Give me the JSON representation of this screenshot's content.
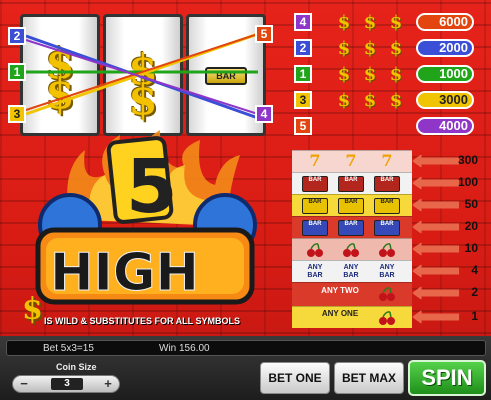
{
  "reels": {
    "reel1": {
      "top": "$",
      "mid": "$"
    },
    "reel2": {
      "top": "$",
      "mid": "$"
    },
    "reel3": {
      "bar": "BAR"
    }
  },
  "payline_markers": {
    "left": [
      {
        "label": "2",
        "color": "#3a4fd6"
      },
      {
        "label": "1",
        "color": "#1fa41a"
      },
      {
        "label": "3",
        "color": "#f0c400"
      }
    ],
    "right": [
      {
        "label": "5",
        "color": "#e2450e"
      },
      {
        "label": "4",
        "color": "#8f35c8"
      }
    ]
  },
  "logo": {
    "number": "5",
    "word": "HIGH"
  },
  "wild_note": {
    "symbol": "$",
    "text": "IS WILD & SUBSTITUTES FOR ALL SYMBOLS"
  },
  "line_wins": [
    {
      "line": "4",
      "symbols": [
        "$",
        "$",
        "$"
      ],
      "value": "6000",
      "color": "#8f35c8"
    },
    {
      "line": "2",
      "symbols": [
        "$",
        "$",
        "$"
      ],
      "value": "2000",
      "color": "#3a4fd6"
    },
    {
      "line": "1",
      "symbols": [
        "$",
        "$",
        "$"
      ],
      "value": "1000",
      "color": "#1fa41a"
    },
    {
      "line": "3",
      "symbols": [
        "$",
        "$",
        "$"
      ],
      "value": "3000",
      "color": "#f0c400"
    },
    {
      "line": "5",
      "symbols": [],
      "value": "4000",
      "color": "#8f35c8"
    }
  ],
  "paytable": [
    {
      "symbols": [
        "7",
        "7",
        "7"
      ],
      "pays": "300"
    },
    {
      "symbols": [
        "BAR",
        "BAR",
        "BAR"
      ],
      "pays": "100"
    },
    {
      "symbols": [
        "BAR",
        "BAR",
        "BAR"
      ],
      "pays": "50"
    },
    {
      "symbols": [
        "BAR",
        "BAR",
        "BAR"
      ],
      "pays": "20"
    },
    {
      "symbols": [
        "cherry",
        "cherry",
        "cherry"
      ],
      "pays": "10"
    },
    {
      "symbols": [
        "ANY BAR",
        "ANY BAR",
        "ANY BAR"
      ],
      "pays": "4"
    },
    {
      "symbols": [
        "ANY TWO",
        "cherry"
      ],
      "pays": "2"
    },
    {
      "symbols": [
        "ANY ONE",
        "cherry"
      ],
      "pays": "1"
    }
  ],
  "status": {
    "bet": "Bet 5x3=15",
    "win": "Win 156.00"
  },
  "coin": {
    "label": "Coin Size",
    "minus": "−",
    "value": "3",
    "plus": "+"
  },
  "buttons": {
    "bet_one": "BET ONE",
    "bet_max": "BET MAX",
    "spin": "SPIN"
  }
}
